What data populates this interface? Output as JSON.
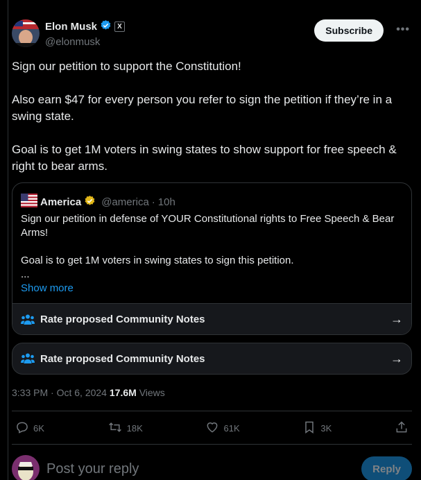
{
  "author": {
    "display_name": "Elon Musk",
    "handle": "@elonmusk",
    "affiliate_badge": "X",
    "verified_color": "#1d9bf0"
  },
  "header": {
    "subscribe_label": "Subscribe",
    "more_label": "•••"
  },
  "tweet": {
    "lines": [
      "Sign our petition to support the Constitution!",
      "Also earn $47 for every person you refer to sign the petition if they’re in a swing state.",
      "Goal is to get 1M voters in swing states to show support for free speech & right to bear arms."
    ]
  },
  "quote": {
    "display_name": "America",
    "handle": "@america",
    "separator": "·",
    "time": "10h",
    "verified_color": "#e2b719",
    "lines": [
      "Sign our petition in defense of YOUR Constitutional rights to Free Speech & Bear Arms!",
      "Goal is to get 1M voters in swing states to sign this petition.",
      "..."
    ],
    "show_more": "Show more",
    "community_notes_label": "Rate proposed Community Notes"
  },
  "community_notes": {
    "label": "Rate proposed Community Notes"
  },
  "meta": {
    "time": "3:33 PM",
    "separator": "·",
    "date": "Oct 6, 2024",
    "views_count": "17.6M",
    "views_label": "Views"
  },
  "actions": {
    "replies": "6K",
    "reposts": "18K",
    "likes": "61K",
    "bookmarks": "3K"
  },
  "reply_box": {
    "placeholder": "Post your reply",
    "button_label": "Reply"
  },
  "colors": {
    "accent": "#1d9bf0",
    "background": "#000000",
    "muted": "#71767b"
  }
}
